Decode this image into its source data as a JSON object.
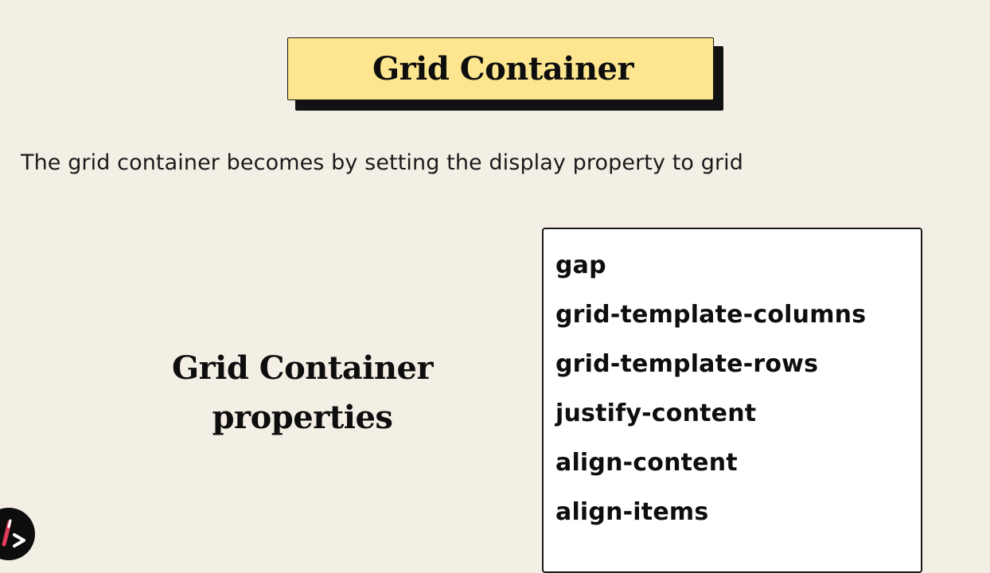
{
  "slide": {
    "title": "Grid Container",
    "subtitle": "The grid container becomes by setting the display property to grid",
    "left_heading_line1": "Grid Container",
    "left_heading_line2": "properties",
    "properties": [
      "gap",
      "grid-template-columns",
      "grid-template-rows",
      "justify-content",
      "align-content",
      "align-items"
    ]
  },
  "logo": {
    "icon": "brush-chevron-logo-icon"
  },
  "colors": {
    "background": "#f4efe5",
    "title_fill": "#fde68f",
    "title_shadow": "#121212",
    "box_fill": "#ffffff",
    "logo_bg": "#0d0d0d",
    "logo_accent": "#e23b5b"
  }
}
